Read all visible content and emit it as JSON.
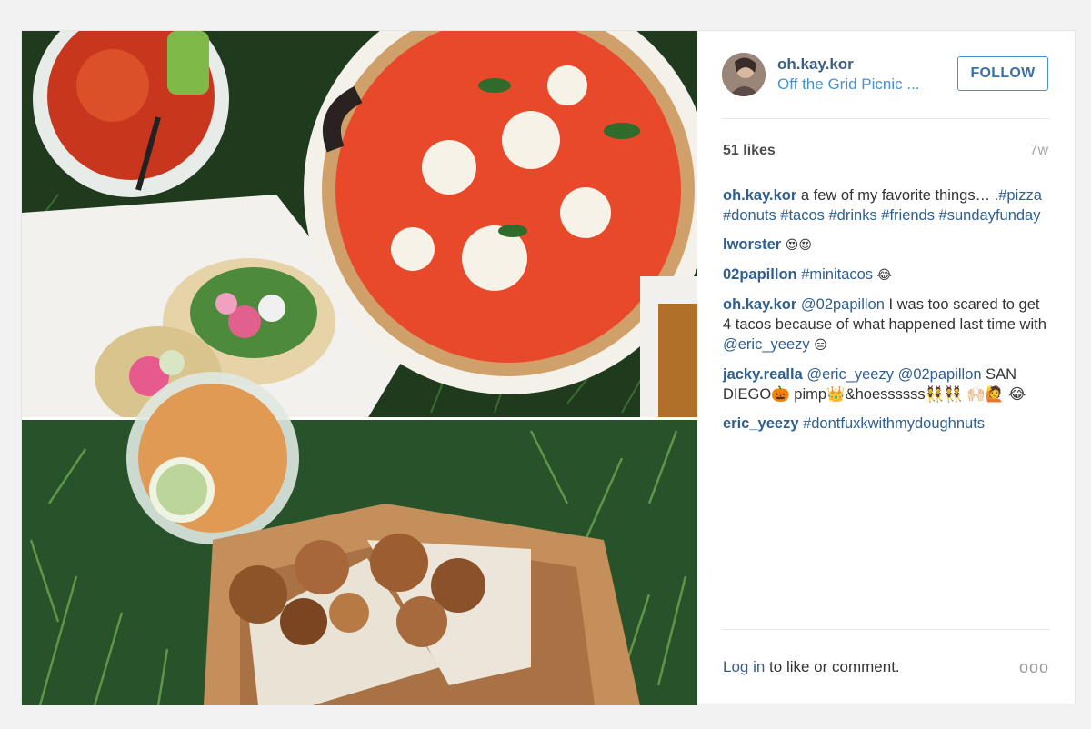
{
  "post": {
    "username": "oh.kay.kor",
    "location": "Off the Grid Picnic ...",
    "follow_label": "FOLLOW",
    "likes": "51 likes",
    "age": "7w",
    "comments": [
      {
        "user": "oh.kay.kor",
        "text": " a few of my favorite things… .",
        "tags": "#pizza #donuts #tacos #drinks #friends #sundayfunday"
      },
      {
        "user": "lworster",
        "text": " ",
        "emoji": "😍😍"
      },
      {
        "user": "02papillon",
        "tags": " #minitacos",
        "emoji": " 😂"
      },
      {
        "user": "oh.kay.kor",
        "mention": " @02papillon",
        "text": " I was too scared to get 4 tacos because of what happened last time with ",
        "mention2": "@eric_yeezy",
        "emoji": " 😑"
      },
      {
        "user": "jacky.realla",
        "mention": " @eric_yeezy @02papillon",
        "text": " SAN DIEGO🎃 pimp👑&hoessssss👯👯 🙌🏻🙋 😂"
      },
      {
        "user": "eric_yeezy",
        "tags": " #dontfuxkwithmydoughnuts"
      }
    ],
    "login_link": "Log in",
    "login_text": " to like or comment.",
    "more_label": "ooo"
  }
}
